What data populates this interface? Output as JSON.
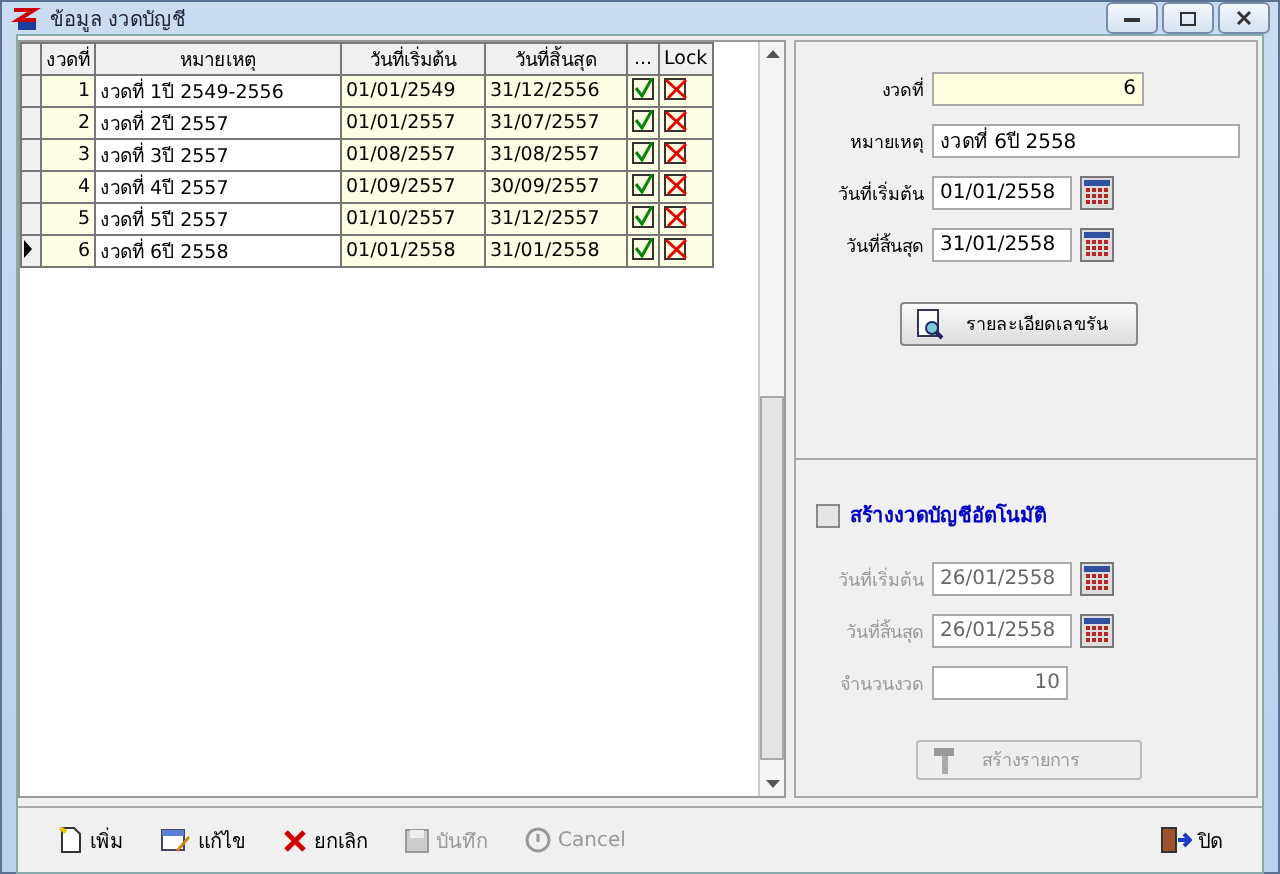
{
  "window": {
    "title": "ข้อมูล งวดบัญชี"
  },
  "grid": {
    "columns": [
      "งวดที่",
      "หมายเหตุ",
      "วันที่เริ่มต้น",
      "วันที่สิ้นสุด",
      "...",
      "Lock"
    ],
    "rows": [
      {
        "no": "1",
        "note": "งวดที่ 1ปี 2549-2556",
        "start": "01/01/2549",
        "end": "31/12/2556",
        "done": true,
        "locked": false,
        "selected": false
      },
      {
        "no": "2",
        "note": "งวดที่ 2ปี 2557",
        "start": "01/01/2557",
        "end": "31/07/2557",
        "done": true,
        "locked": false,
        "selected": false
      },
      {
        "no": "3",
        "note": "งวดที่ 3ปี 2557",
        "start": "01/08/2557",
        "end": "31/08/2557",
        "done": true,
        "locked": false,
        "selected": false
      },
      {
        "no": "4",
        "note": "งวดที่ 4ปี 2557",
        "start": "01/09/2557",
        "end": "30/09/2557",
        "done": true,
        "locked": false,
        "selected": false
      },
      {
        "no": "5",
        "note": "งวดที่ 5ปี 2557",
        "start": "01/10/2557",
        "end": "31/12/2557",
        "done": true,
        "locked": false,
        "selected": false
      },
      {
        "no": "6",
        "note": "งวดที่ 6ปี 2558",
        "start": "01/01/2558",
        "end": "31/01/2558",
        "done": true,
        "locked": false,
        "selected": true
      }
    ]
  },
  "detail": {
    "fields": [
      {
        "label": "งวดที่",
        "value": "6",
        "kind": "number"
      },
      {
        "label": "หมายเหตุ",
        "value": "งวดที่ 6ปี 2558",
        "kind": "text"
      },
      {
        "label": "วันที่เริ่มต้น",
        "value": "01/01/2558",
        "kind": "date"
      },
      {
        "label": "วันที่สิ้นสุด",
        "value": "31/01/2558",
        "kind": "date"
      }
    ],
    "button": "รายละเอียดเลขรัน"
  },
  "auto": {
    "checkbox": {
      "label": "สร้างงวดบัญชีอัตโนมัติ",
      "checked": false
    },
    "fields": [
      {
        "label": "วันที่เริ่มต้น",
        "value": "26/01/2558",
        "kind": "date"
      },
      {
        "label": "วันที่สิ้นสุด",
        "value": "26/01/2558",
        "kind": "date"
      },
      {
        "label": "จำนวนงวด",
        "value": "10",
        "kind": "number"
      }
    ],
    "button": "สร้างรายการ",
    "disabled": true
  },
  "toolbar": [
    {
      "label": "เพิ่ม",
      "kind": "add",
      "disabled": false
    },
    {
      "label": "แก้ไข",
      "kind": "edit",
      "disabled": false
    },
    {
      "label": "ยกเลิก",
      "kind": "delete",
      "disabled": false
    },
    {
      "label": "บันทึก",
      "kind": "save",
      "disabled": true
    },
    {
      "label": "Cancel",
      "kind": "cancel",
      "disabled": true
    },
    {
      "label": "ปิด",
      "kind": "close",
      "disabled": false
    }
  ]
}
